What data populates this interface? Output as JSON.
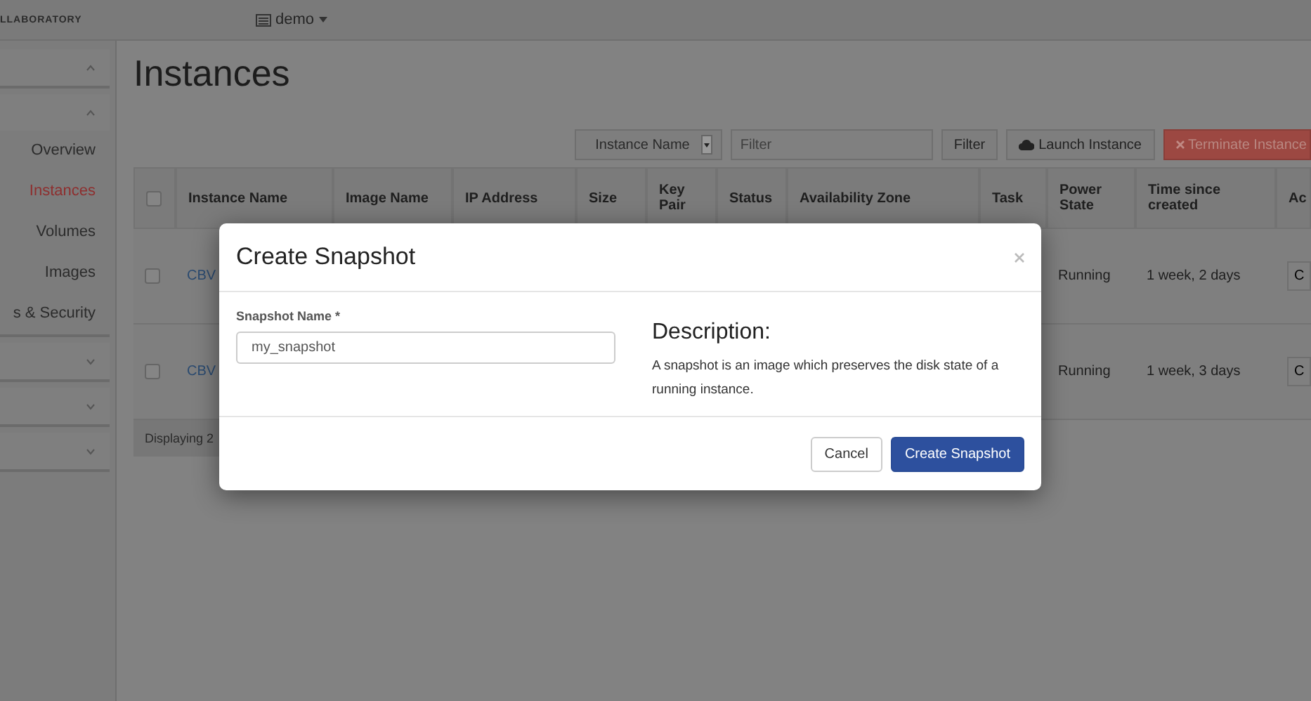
{
  "topbar": {
    "brand": "LLABORATORY",
    "project": "demo"
  },
  "sidebar": {
    "sections": [
      {
        "expanded": true
      },
      {
        "expanded": true,
        "items": [
          {
            "label": "Overview",
            "selected": false
          },
          {
            "label": "Instances",
            "selected": true
          },
          {
            "label": "Volumes",
            "selected": false
          },
          {
            "label": "Images",
            "selected": false
          },
          {
            "label": "s & Security",
            "selected": false
          }
        ]
      },
      {
        "expanded": false
      },
      {
        "expanded": false
      },
      {
        "expanded": false
      }
    ]
  },
  "page_title": "Instances",
  "toolbar": {
    "filter_select": "Instance Name",
    "filter_field": {
      "placeholder": "Filter"
    },
    "filter_button": "Filter",
    "launch_button": "Launch Instance",
    "terminate_button": "Terminate Instance"
  },
  "table": {
    "select_all_checked": false,
    "columns": [
      "Instance Name",
      "Image Name",
      "IP Address",
      "Size",
      "Key Pair",
      "Status",
      "Availability Zone",
      "Task",
      "Power State",
      "Time since created",
      "Ac"
    ],
    "rows": [
      {
        "checked": false,
        "name": "CBV",
        "power_state": "Running",
        "time_since_created": "1 week, 2 days",
        "action": "C"
      },
      {
        "checked": false,
        "name": "CBV",
        "power_state": "Running",
        "time_since_created": "1 week, 3 days",
        "action": "C"
      }
    ],
    "footer": "Displaying 2"
  },
  "modal": {
    "title": "Create Snapshot",
    "field_label": "Snapshot Name *",
    "field_value": "my_snapshot",
    "description_title": "Description:",
    "description": "A snapshot is an image which preserves the disk state of a running instance.",
    "buttons": [
      "Cancel",
      "Create Snapshot"
    ]
  }
}
